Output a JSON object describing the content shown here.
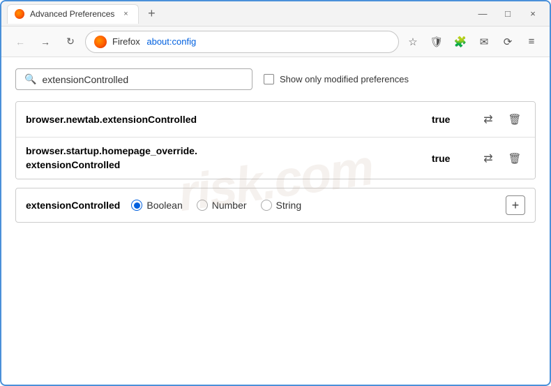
{
  "titleBar": {
    "tabTitle": "Advanced Preferences",
    "tabCloseLabel": "×",
    "newTabLabel": "+",
    "minimizeLabel": "—",
    "maximizeLabel": "□",
    "closeLabel": "×"
  },
  "navBar": {
    "backLabel": "←",
    "forwardLabel": "→",
    "reloadLabel": "↻",
    "firefoxLabel": "Firefox",
    "addressUrl": "about:config",
    "bookmarkLabel": "☆",
    "shieldLabel": "🛡",
    "extensionLabel": "🧩",
    "accountLabel": "✉",
    "syncLabel": "⟳",
    "menuLabel": "≡"
  },
  "search": {
    "placeholder": "extensionControlled",
    "showModifiedLabel": "Show only modified preferences"
  },
  "preferences": [
    {
      "name": "browser.newtab.extensionControlled",
      "value": "true"
    },
    {
      "name1": "browser.startup.homepage_override.",
      "name2": "extensionControlled",
      "value": "true"
    }
  ],
  "newPref": {
    "name": "extensionControlled",
    "types": [
      "Boolean",
      "Number",
      "String"
    ]
  },
  "watermark": {
    "line1": "risk.com"
  },
  "icons": {
    "swap": "⇄",
    "delete": "🗑",
    "add": "+"
  }
}
